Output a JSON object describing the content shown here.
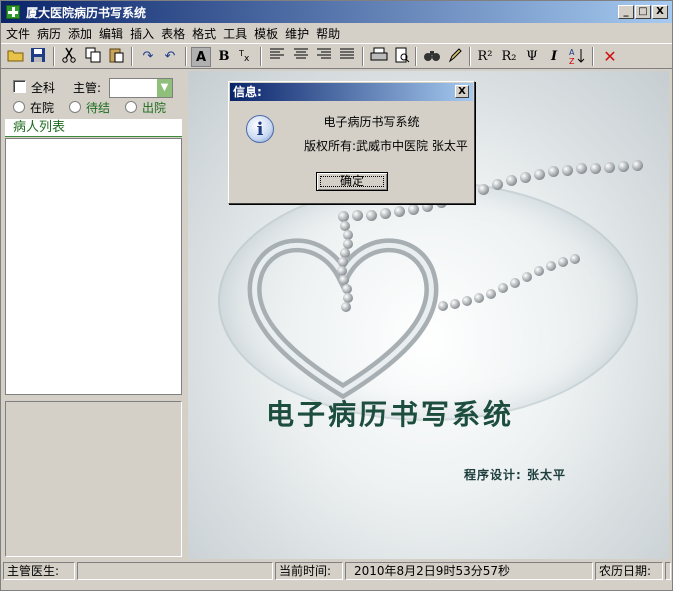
{
  "window": {
    "title": "厦大医院病历书写系统",
    "min_label": "_",
    "max_label": "□",
    "close_label": "X"
  },
  "menu": [
    "文件",
    "病历",
    "添加",
    "编辑",
    "插入",
    "表格",
    "格式",
    "工具",
    "模板",
    "维护",
    "帮助"
  ],
  "toolbar": {
    "bold_label": "B",
    "font_label": "A",
    "superscript_label": "R²",
    "subscript_label": "R₂",
    "psi_label": "Ψ",
    "italic_label": "I"
  },
  "left_panel": {
    "all_departments_label": "全科",
    "supervisor_label": "主管:",
    "supervisor_value": "",
    "radio_inpatient": "在院",
    "radio_pending": "待结",
    "radio_discharged": "出院",
    "patient_list_header": "病人列表",
    "patients": []
  },
  "main": {
    "app_title": "电子病历书写系统",
    "designer": "程序设计: 张太平"
  },
  "statusbar": {
    "doctor_label": "主管医生:",
    "doctor_value": "",
    "time_label": "当前时间:",
    "time_value": "2010年8月2日9时53分57秒",
    "lunar_label": "农历日期:"
  },
  "dialog": {
    "title": "信息:",
    "close_label": "X",
    "icon": "info-icon",
    "message1": "电子病历书写系统",
    "message2": "版权所有:武威市中医院 张太平",
    "ok_label": "确定"
  }
}
